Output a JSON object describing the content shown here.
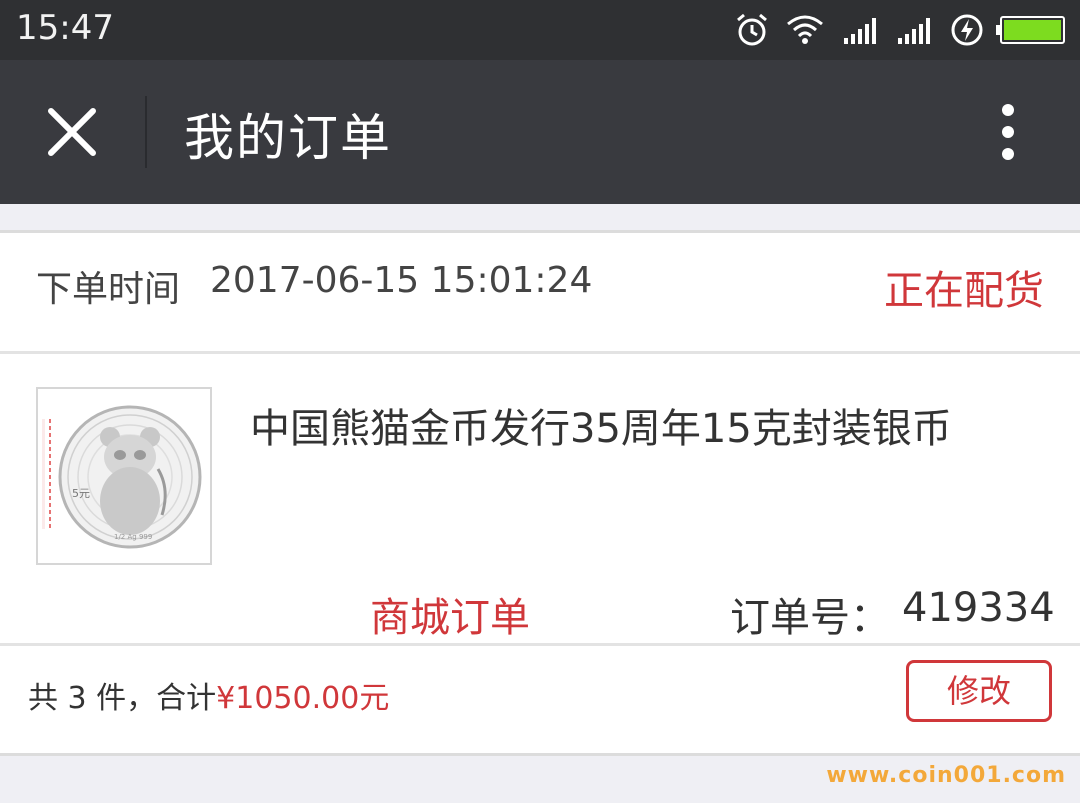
{
  "status_bar": {
    "time": "15:47",
    "icons": [
      "alarm-icon",
      "wifi-icon",
      "signal-icon",
      "signal-icon",
      "charging-icon",
      "battery-icon"
    ],
    "battery_color": "#7ddc1f"
  },
  "title_bar": {
    "title": "我的订单",
    "close_icon": "close-icon",
    "more_icon": "more-vertical-icon"
  },
  "order": {
    "time_label": "下单时间",
    "time_value": "2017-06-15 15:01:24",
    "status": "正在配货",
    "product": {
      "name": "中国熊猫金币发行35周年15克封装银币",
      "image_icon": "panda-coin-image"
    },
    "type": "商城订单",
    "order_no_label": "订单号：",
    "order_no_value": "419334",
    "summary_prefix": "共 3 件，合计",
    "total": "¥1050.00元",
    "modify_button": "修改"
  },
  "colors": {
    "accent": "#d0373a",
    "titlebar": "#393a3f",
    "statusbar": "#2f3033",
    "background": "#efeff4"
  },
  "watermark": "www.coin001.com"
}
